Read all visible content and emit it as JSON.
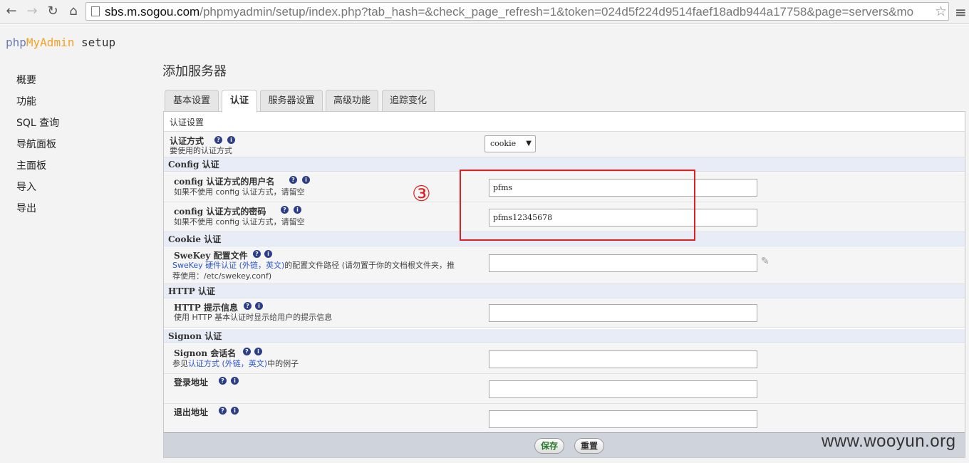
{
  "browser": {
    "url_host": "sbs.m.sogou.com",
    "url_rest": "/phpmyadmin/setup/index.php?tab_hash=&check_page_refresh=1&token=024d5f224d9514faef18adb944a17758&page=servers&mo"
  },
  "logo": {
    "php": "php",
    "my": "My",
    "admin": "Admin",
    "suffix": " setup"
  },
  "sidebar": {
    "items": [
      {
        "label": "概要"
      },
      {
        "label": "功能"
      },
      {
        "label": "SQL 查询"
      },
      {
        "label": "导航面板"
      },
      {
        "label": "主面板"
      },
      {
        "label": "导入"
      },
      {
        "label": "导出"
      }
    ]
  },
  "page": {
    "title": "添加服务器",
    "tabs": [
      {
        "label": "基本设置"
      },
      {
        "label": "认证"
      },
      {
        "label": "服务器设置"
      },
      {
        "label": "高级功能"
      },
      {
        "label": "追踪变化"
      }
    ],
    "active_tab": "认证"
  },
  "form": {
    "legend": "认证设置",
    "auth_type": {
      "label": "认证方式",
      "desc": "要使用的认证方式",
      "value": "cookie"
    },
    "group_config": "Config 认证",
    "config_user": {
      "label": "config 认证方式的用户名",
      "desc": "如果不使用 config 认证方式，请留空",
      "value": "pfms"
    },
    "config_pass": {
      "label": "config 认证方式的密码",
      "desc": "如果不使用 config 认证方式，请留空",
      "value": "pfms12345678"
    },
    "group_cookie": "Cookie 认证",
    "swekey": {
      "label": "SweKey 配置文件",
      "desc_link": "SweKey 硬件认证 (外链，英文)",
      "desc_rest": "的配置文件路径 (请勿置于你的文档根文件夹，推",
      "desc_line2": "荐使用：/etc/swekey.conf)",
      "value": ""
    },
    "group_http": "HTTP 认证",
    "http_realm": {
      "label": "HTTP 提示信息",
      "desc": "使用 HTTP 基本认证时显示给用户的提示信息",
      "value": ""
    },
    "group_signon": "Signon 认证",
    "signon_session": {
      "label": "Signon 会话名",
      "desc_prefix": "参见",
      "desc_link": "认证方式 (外链，英文)",
      "desc_suffix": "中的例子",
      "value": ""
    },
    "signon_login": {
      "label": "登录地址",
      "value": ""
    },
    "signon_logout": {
      "label": "退出地址",
      "value": ""
    },
    "save_label": "保存",
    "reset_label": "重置"
  },
  "annotation": {
    "number": "③",
    "color": "#e02020"
  },
  "watermark": "www.wooyun.org",
  "icons": {
    "help": "?",
    "info": "i"
  }
}
